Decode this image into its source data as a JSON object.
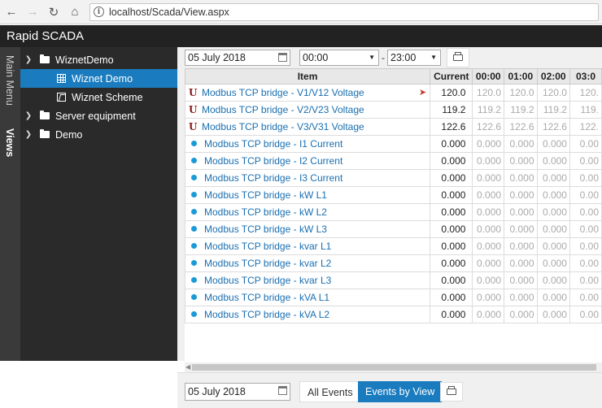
{
  "browser": {
    "url": "localhost/Scada/View.aspx"
  },
  "app": {
    "title": "Rapid SCADA"
  },
  "vtabs": {
    "main_menu": "Main Menu",
    "views": "Views"
  },
  "tree": {
    "nodes": [
      {
        "label": "WiznetDemo"
      },
      {
        "label": "Wiznet Demo"
      },
      {
        "label": "Wiznet Scheme"
      },
      {
        "label": "Server equipment"
      },
      {
        "label": "Demo"
      }
    ]
  },
  "toolbar": {
    "date": "05 July 2018",
    "time_from": "00:00",
    "dash": "-",
    "time_to": "23:00"
  },
  "table": {
    "headers": {
      "item": "Item",
      "current": "Current",
      "h0": "00:00",
      "h1": "01:00",
      "h2": "02:00",
      "h3": "03:0"
    },
    "rows": [
      {
        "icon": "U",
        "item": "Modbus TCP bridge - V1/V12 Voltage",
        "current": "120.0",
        "hours": [
          "120.0",
          "120.0",
          "120.0",
          "120."
        ]
      },
      {
        "icon": "U",
        "item": "Modbus TCP bridge - V2/V23 Voltage",
        "current": "119.2",
        "hours": [
          "119.2",
          "119.2",
          "119.2",
          "119."
        ]
      },
      {
        "icon": "U",
        "item": "Modbus TCP bridge - V3/V31 Voltage",
        "current": "122.6",
        "hours": [
          "122.6",
          "122.6",
          "122.6",
          "122."
        ]
      },
      {
        "item": "Modbus TCP bridge - I1 Current",
        "current": "0.000",
        "hours": [
          "0.000",
          "0.000",
          "0.000",
          "0.00"
        ]
      },
      {
        "item": "Modbus TCP bridge - I2 Current",
        "current": "0.000",
        "hours": [
          "0.000",
          "0.000",
          "0.000",
          "0.00"
        ]
      },
      {
        "item": "Modbus TCP bridge - I3 Current",
        "current": "0.000",
        "hours": [
          "0.000",
          "0.000",
          "0.000",
          "0.00"
        ]
      },
      {
        "item": "Modbus TCP bridge - kW L1",
        "current": "0.000",
        "hours": [
          "0.000",
          "0.000",
          "0.000",
          "0.00"
        ]
      },
      {
        "item": "Modbus TCP bridge - kW L2",
        "current": "0.000",
        "hours": [
          "0.000",
          "0.000",
          "0.000",
          "0.00"
        ]
      },
      {
        "item": "Modbus TCP bridge - kW L3",
        "current": "0.000",
        "hours": [
          "0.000",
          "0.000",
          "0.000",
          "0.00"
        ]
      },
      {
        "item": "Modbus TCP bridge - kvar L1",
        "current": "0.000",
        "hours": [
          "0.000",
          "0.000",
          "0.000",
          "0.00"
        ]
      },
      {
        "item": "Modbus TCP bridge - kvar L2",
        "current": "0.000",
        "hours": [
          "0.000",
          "0.000",
          "0.000",
          "0.00"
        ]
      },
      {
        "item": "Modbus TCP bridge - kvar L3",
        "current": "0.000",
        "hours": [
          "0.000",
          "0.000",
          "0.000",
          "0.00"
        ]
      },
      {
        "item": "Modbus TCP bridge - kVA L1",
        "current": "0.000",
        "hours": [
          "0.000",
          "0.000",
          "0.000",
          "0.00"
        ]
      },
      {
        "item": "Modbus TCP bridge - kVA L2",
        "current": "0.000",
        "hours": [
          "0.000",
          "0.000",
          "0.000",
          "0.00"
        ]
      }
    ]
  },
  "bottom": {
    "date": "05 July 2018",
    "all_events": "All Events",
    "events_by_view": "Events by View"
  },
  "colors": {
    "accent": "#1a7cbf",
    "header_bg": "#222222",
    "tree_bg": "#2a2a2a",
    "link": "#1a6fb0",
    "voltage_icon": "#8b1a1a",
    "dot": "#1a9ad6"
  }
}
